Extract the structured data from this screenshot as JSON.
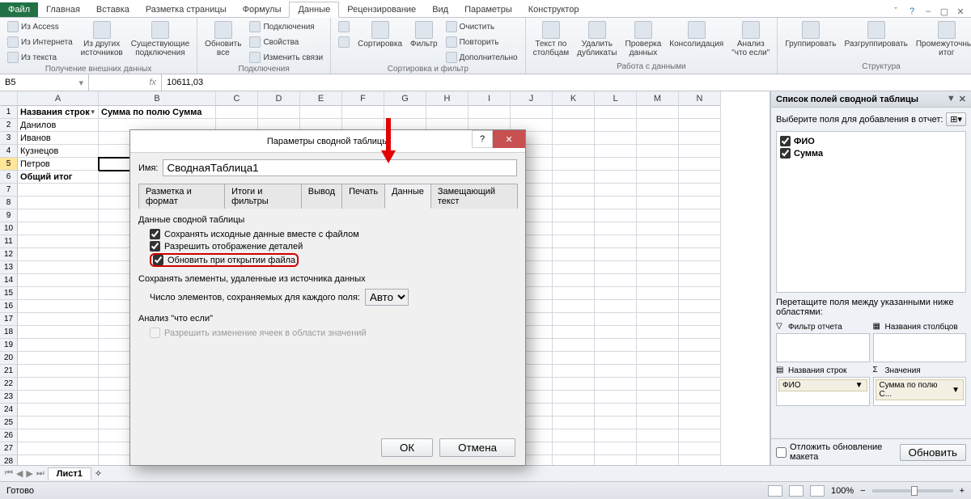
{
  "tabs": {
    "file": "Файл",
    "home": "Главная",
    "insert": "Вставка",
    "layout": "Разметка страницы",
    "formulas": "Формулы",
    "data": "Данные",
    "review": "Рецензирование",
    "view": "Вид",
    "options": "Параметры",
    "design": "Конструктор"
  },
  "ribbon": {
    "ext": {
      "access": "Из Access",
      "web": "Из Интернета",
      "text": "Из текста",
      "other": "Из других\nисточников",
      "existing": "Существующие\nподключения",
      "group": "Получение внешних данных"
    },
    "conn": {
      "refresh": "Обновить\nвсе",
      "props": "Подключения",
      "propsBtn": "Свойства",
      "edit": "Изменить связи",
      "group": "Подключения"
    },
    "sort": {
      "sort": "Сортировка",
      "filter": "Фильтр",
      "clear": "Очистить",
      "reapply": "Повторить",
      "adv": "Дополнительно",
      "group": "Сортировка и фильтр"
    },
    "tools": {
      "text": "Текст по\nстолбцам",
      "dup": "Удалить\nдубликаты",
      "valid": "Проверка\nданных",
      "cons": "Консолидация",
      "whatif": "Анализ\n\"что если\"",
      "group": "Работа с данными"
    },
    "struct": {
      "group": "Группировать",
      "ungroup": "Разгруппировать",
      "subtotal": "Промежуточный\nитог",
      "grouplbl": "Структура"
    }
  },
  "formula": {
    "name": "B5",
    "value": "10611,03"
  },
  "columns": [
    "A",
    "B",
    "C",
    "D",
    "E",
    "F",
    "G",
    "H",
    "I",
    "J",
    "K",
    "L",
    "M",
    "N"
  ],
  "sheet": {
    "header": {
      "a": "Названия строк",
      "b": "Сумма по полю Сумма"
    },
    "rows": [
      {
        "n": "2",
        "a": "Данилов"
      },
      {
        "n": "3",
        "a": "Иванов"
      },
      {
        "n": "4",
        "a": "Кузнецов"
      },
      {
        "n": "5",
        "a": "Петров"
      },
      {
        "n": "6",
        "a": "Общий итог"
      }
    ]
  },
  "modal": {
    "title": "Параметры сводной таблицы",
    "nameLabel": "Имя:",
    "nameValue": "СводнаяТаблица1",
    "tabs": [
      "Разметка и формат",
      "Итоги и фильтры",
      "Вывод",
      "Печать",
      "Данные",
      "Замещающий текст"
    ],
    "activeTab": 4,
    "g1": "Данные сводной таблицы",
    "c1": "Сохранять исходные данные вместе с файлом",
    "c2": "Разрешить отображение деталей",
    "c3": "Обновить при открытии файла",
    "g2": "Сохранять элементы, удаленные из источника данных",
    "countLabel": "Число элементов, сохраняемых для каждого поля:",
    "countValue": "Авто",
    "g3": "Анализ \"что если\"",
    "c4": "Разрешить изменение ячеек в области значений",
    "ok": "ОК",
    "cancel": "Отмена"
  },
  "pane": {
    "title": "Список полей сводной таблицы",
    "hint": "Выберите поля для добавления в отчет:",
    "fields": [
      {
        "label": "ФИО",
        "checked": true
      },
      {
        "label": "Сумма",
        "checked": true
      }
    ],
    "dragHint": "Перетащите поля между указанными ниже областями:",
    "areas": {
      "filter": "Фильтр отчета",
      "cols": "Названия столбцов",
      "rows": "Названия строк",
      "vals": "Значения"
    },
    "rowChip": "ФИО",
    "valChip": "Сумма по полю С...",
    "defer": "Отложить обновление макета",
    "update": "Обновить"
  },
  "sheetTab": "Лист1",
  "status": {
    "ready": "Готово",
    "zoom": "100%"
  },
  "chart_data": null
}
